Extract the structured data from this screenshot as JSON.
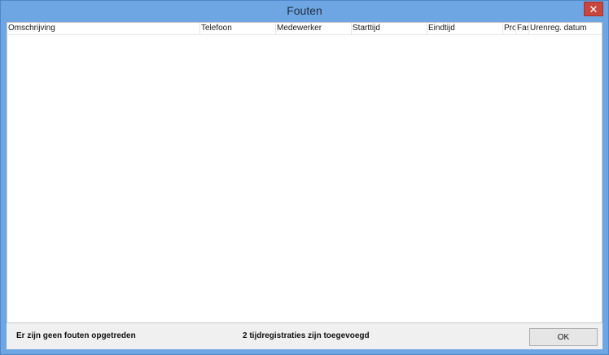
{
  "window": {
    "title": "Fouten",
    "close_glyph": "✕",
    "close_icon": "close-icon"
  },
  "table": {
    "columns": [
      "Omschrijving",
      "Telefoon",
      "Medewerker",
      "Starttijd",
      "Eindtijd",
      "Pro",
      "Fas",
      "Urenreg. datum"
    ],
    "rows": []
  },
  "status": {
    "errors_text": "Er zijn geen fouten opgetreden",
    "added_text": "2 tijdregistraties zijn toegevoegd"
  },
  "buttons": {
    "ok_label": "OK"
  },
  "colors": {
    "title_bar": "#6ea6e4",
    "close_button": "#c7463e",
    "dialog_background": "#f0f0f0"
  }
}
